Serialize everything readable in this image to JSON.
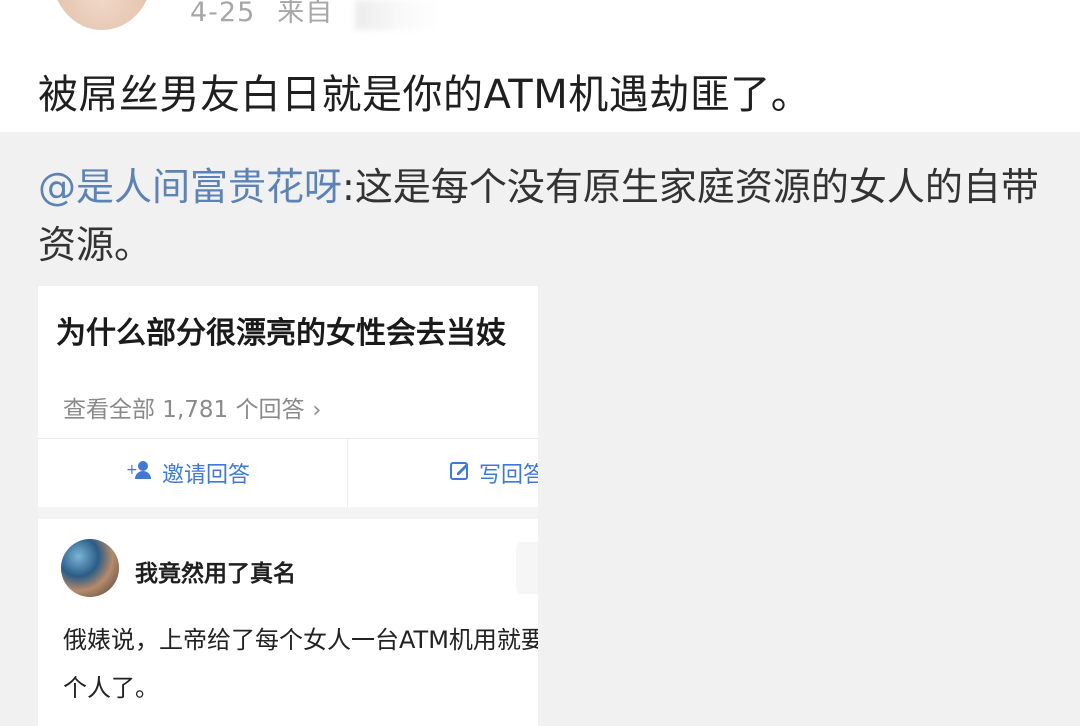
{
  "post": {
    "date": "4-25",
    "source_prefix": "来自",
    "text": "被屌丝男友白日就是你的ATM机遇劫匪了。"
  },
  "repost": {
    "user": "@是人间富贵花呀",
    "text": ":这是每个没有原生家庭资源的女人的自带资源。"
  },
  "embed": {
    "question_title": "为什么部分很漂亮的女性会去当妓",
    "view_all": "查看全部 1,781 个回答",
    "invite_label": "邀请回答",
    "write_label": "写回答",
    "answer": {
      "author": "我竟然用了真名",
      "text": "俄婊说，上帝给了每个女人一台ATM机用就要看个人了。"
    }
  },
  "colors": {
    "link_blue": "#5d83b6",
    "action_blue": "#3f79d8",
    "repost_bg": "#f1f1f1",
    "meta_gray": "#a7a7a7"
  }
}
